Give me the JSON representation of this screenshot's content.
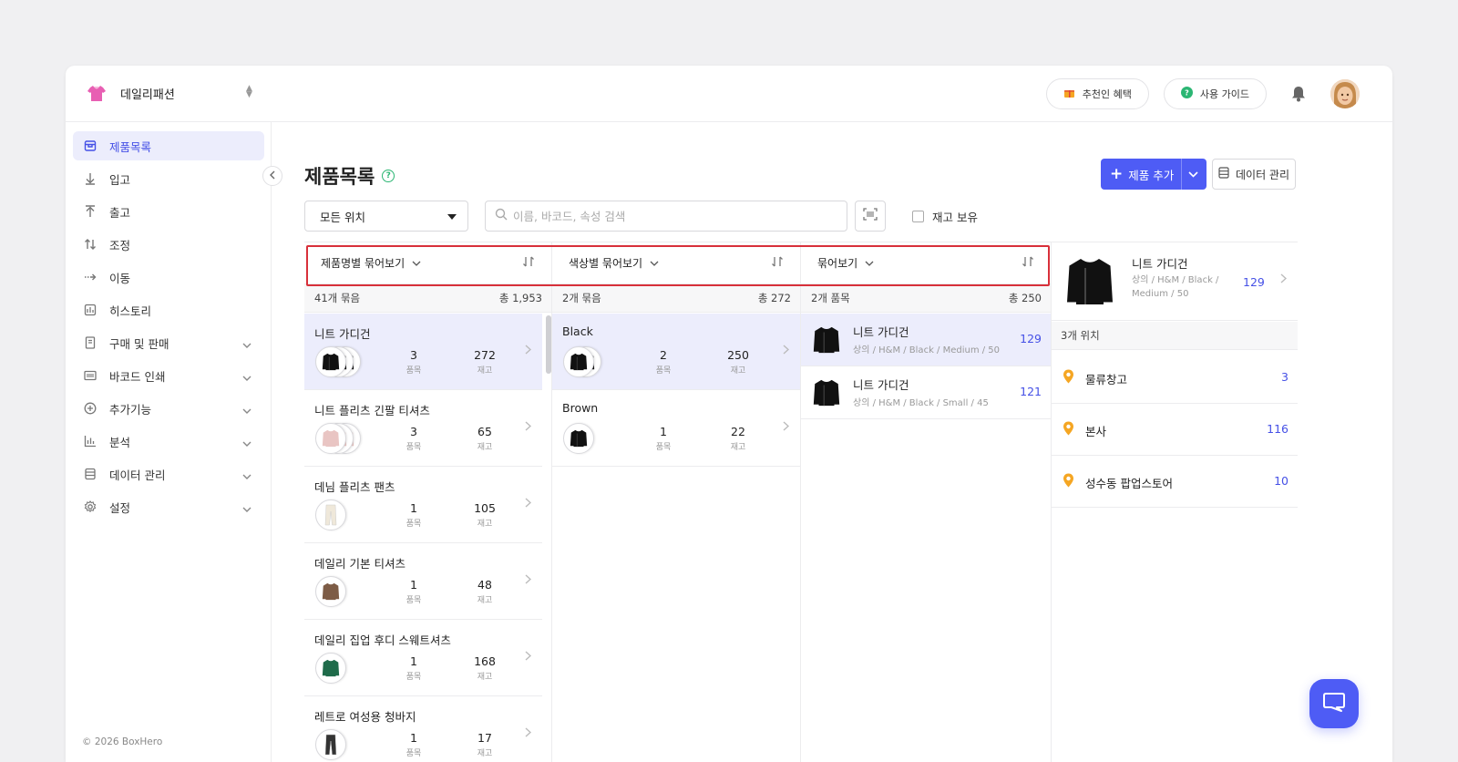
{
  "brand": {
    "name": "데일리패션"
  },
  "top_actions": {
    "referral": "추천인 혜택",
    "guide": "사용 가이드"
  },
  "sidebar": {
    "items": [
      {
        "label": "제품목록",
        "icon": "box-icon",
        "active": true,
        "expandable": false
      },
      {
        "label": "입고",
        "icon": "arrow-down-icon",
        "active": false,
        "expandable": false
      },
      {
        "label": "출고",
        "icon": "arrow-up-icon",
        "active": false,
        "expandable": false
      },
      {
        "label": "조정",
        "icon": "swap-icon",
        "active": false,
        "expandable": false
      },
      {
        "label": "이동",
        "icon": "move-icon",
        "active": false,
        "expandable": false
      },
      {
        "label": "히스토리",
        "icon": "history-icon",
        "active": false,
        "expandable": false
      },
      {
        "label": "구매 및 판매",
        "icon": "document-icon",
        "active": false,
        "expandable": true
      },
      {
        "label": "바코드 인쇄",
        "icon": "barcode-icon",
        "active": false,
        "expandable": true
      },
      {
        "label": "추가기능",
        "icon": "plus-circle-icon",
        "active": false,
        "expandable": true
      },
      {
        "label": "분석",
        "icon": "chart-icon",
        "active": false,
        "expandable": true
      },
      {
        "label": "데이터 관리",
        "icon": "database-icon",
        "active": false,
        "expandable": true
      },
      {
        "label": "설정",
        "icon": "gear-icon",
        "active": false,
        "expandable": true
      }
    ],
    "copyright": "© 2026 BoxHero"
  },
  "page": {
    "title": "제품목록",
    "add_button": "제품 추가",
    "data_button": "데이터 관리",
    "location_select": "모든 위치",
    "search_placeholder": "이름, 바코드, 속성 검색",
    "stock_checkbox": "재고 보유"
  },
  "columns": {
    "product_group": {
      "header": "제품명별 묶어보기",
      "count": "41개 묶음",
      "total": "총 1,953"
    },
    "color_group": {
      "header": "색상별 묶어보기",
      "count": "2개 묶음",
      "total": "총 272"
    },
    "group_view": {
      "header": "묶어보기",
      "count": "2개 품목",
      "total": "총 250"
    }
  },
  "labels": {
    "items": "품목",
    "stock": "재고"
  },
  "product_groups": [
    {
      "name": "니트 가디건",
      "items": "3",
      "stock": "272",
      "thumb": "black",
      "thumbs": 3,
      "active": true
    },
    {
      "name": "니트 플리츠 긴팔 티셔츠",
      "items": "3",
      "stock": "65",
      "thumb": "pink",
      "thumbs": 3,
      "active": false
    },
    {
      "name": "데님 플리츠 팬츠",
      "items": "1",
      "stock": "105",
      "thumb": "cream",
      "thumbs": 1,
      "active": false
    },
    {
      "name": "데일리 기본 티셔츠",
      "items": "1",
      "stock": "48",
      "thumb": "brown",
      "thumbs": 1,
      "active": false
    },
    {
      "name": "데일리 집업 후디 스웨트셔츠",
      "items": "1",
      "stock": "168",
      "thumb": "green",
      "thumbs": 1,
      "active": false
    },
    {
      "name": "레트로 여성용 청바지",
      "items": "1",
      "stock": "17",
      "thumb": "dark",
      "thumbs": 1,
      "active": false
    }
  ],
  "color_groups": [
    {
      "name": "Black",
      "items": "2",
      "stock": "250",
      "thumbs": 2,
      "active": true
    },
    {
      "name": "Brown",
      "items": "1",
      "stock": "22",
      "thumbs": 1,
      "active": false
    }
  ],
  "items": [
    {
      "name": "니트 가디건",
      "sub": "상의 / H&M / Black / Medium / 50",
      "qty": "129",
      "active": true
    },
    {
      "name": "니트 가디건",
      "sub": "상의 / H&M / Black / Small / 45",
      "qty": "121",
      "active": false
    }
  ],
  "detail": {
    "name": "니트 가디건",
    "sub": "상의 / H&M / Black / Medium / 50",
    "qty": "129",
    "location_count": "3개 위치",
    "locations": [
      {
        "name": "물류창고",
        "qty": "3"
      },
      {
        "name": "본사",
        "qty": "116"
      },
      {
        "name": "성수동 팝업스토어",
        "qty": "10"
      }
    ]
  },
  "colors": {
    "accent": "#4e5cf5",
    "active_bg": "#ecedfc",
    "highlight": "#d8303a",
    "pin": "#f5a623"
  }
}
